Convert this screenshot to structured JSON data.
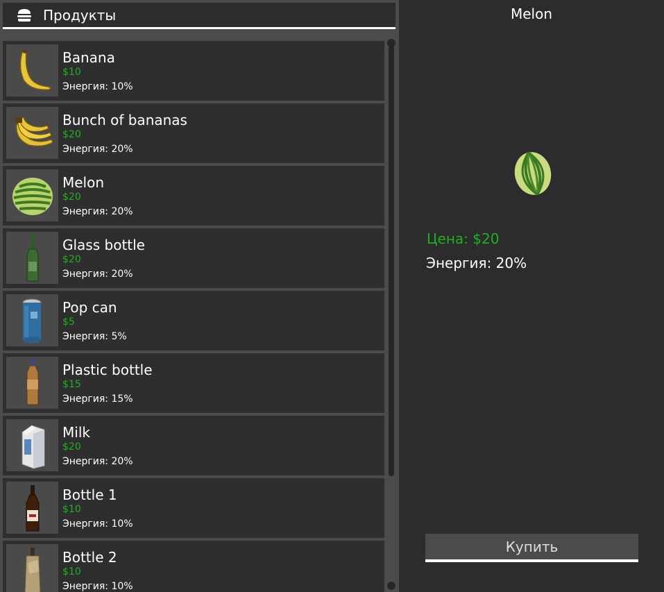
{
  "header": {
    "title": "Продукты",
    "icon": "burger-icon"
  },
  "products": [
    {
      "name": "Banana",
      "price": "$10",
      "energy": "Энергия: 10%",
      "icon": "banana-icon"
    },
    {
      "name": "Bunch of bananas",
      "price": "$20",
      "energy": "Энергия: 20%",
      "icon": "banana-bunch-icon"
    },
    {
      "name": "Melon",
      "price": "$20",
      "energy": "Энергия: 20%",
      "icon": "melon-icon"
    },
    {
      "name": "Glass bottle",
      "price": "$20",
      "energy": "Энергия: 20%",
      "icon": "glass-bottle-icon"
    },
    {
      "name": "Pop can",
      "price": "$5",
      "energy": "Энергия: 5%",
      "icon": "pop-can-icon"
    },
    {
      "name": "Plastic bottle",
      "price": "$15",
      "energy": "Энергия: 15%",
      "icon": "plastic-bottle-icon"
    },
    {
      "name": "Milk",
      "price": "$20",
      "energy": "Энергия: 20%",
      "icon": "milk-carton-icon"
    },
    {
      "name": "Bottle 1",
      "price": "$10",
      "energy": "Энергия: 10%",
      "icon": "bottle-icon"
    },
    {
      "name": "Bottle 2",
      "price": "$10",
      "energy": "Энергия: 10%",
      "icon": "bottle-paper-bag-icon"
    }
  ],
  "detail": {
    "title": "Melon",
    "price": "Цена: $20",
    "energy": "Энергия: 20%",
    "icon": "melon-icon",
    "buy_label": "Купить"
  },
  "colors": {
    "price_green": "#1db21d",
    "panel_dark": "#2c2c2c",
    "panel_gray": "#4b4b4b"
  }
}
